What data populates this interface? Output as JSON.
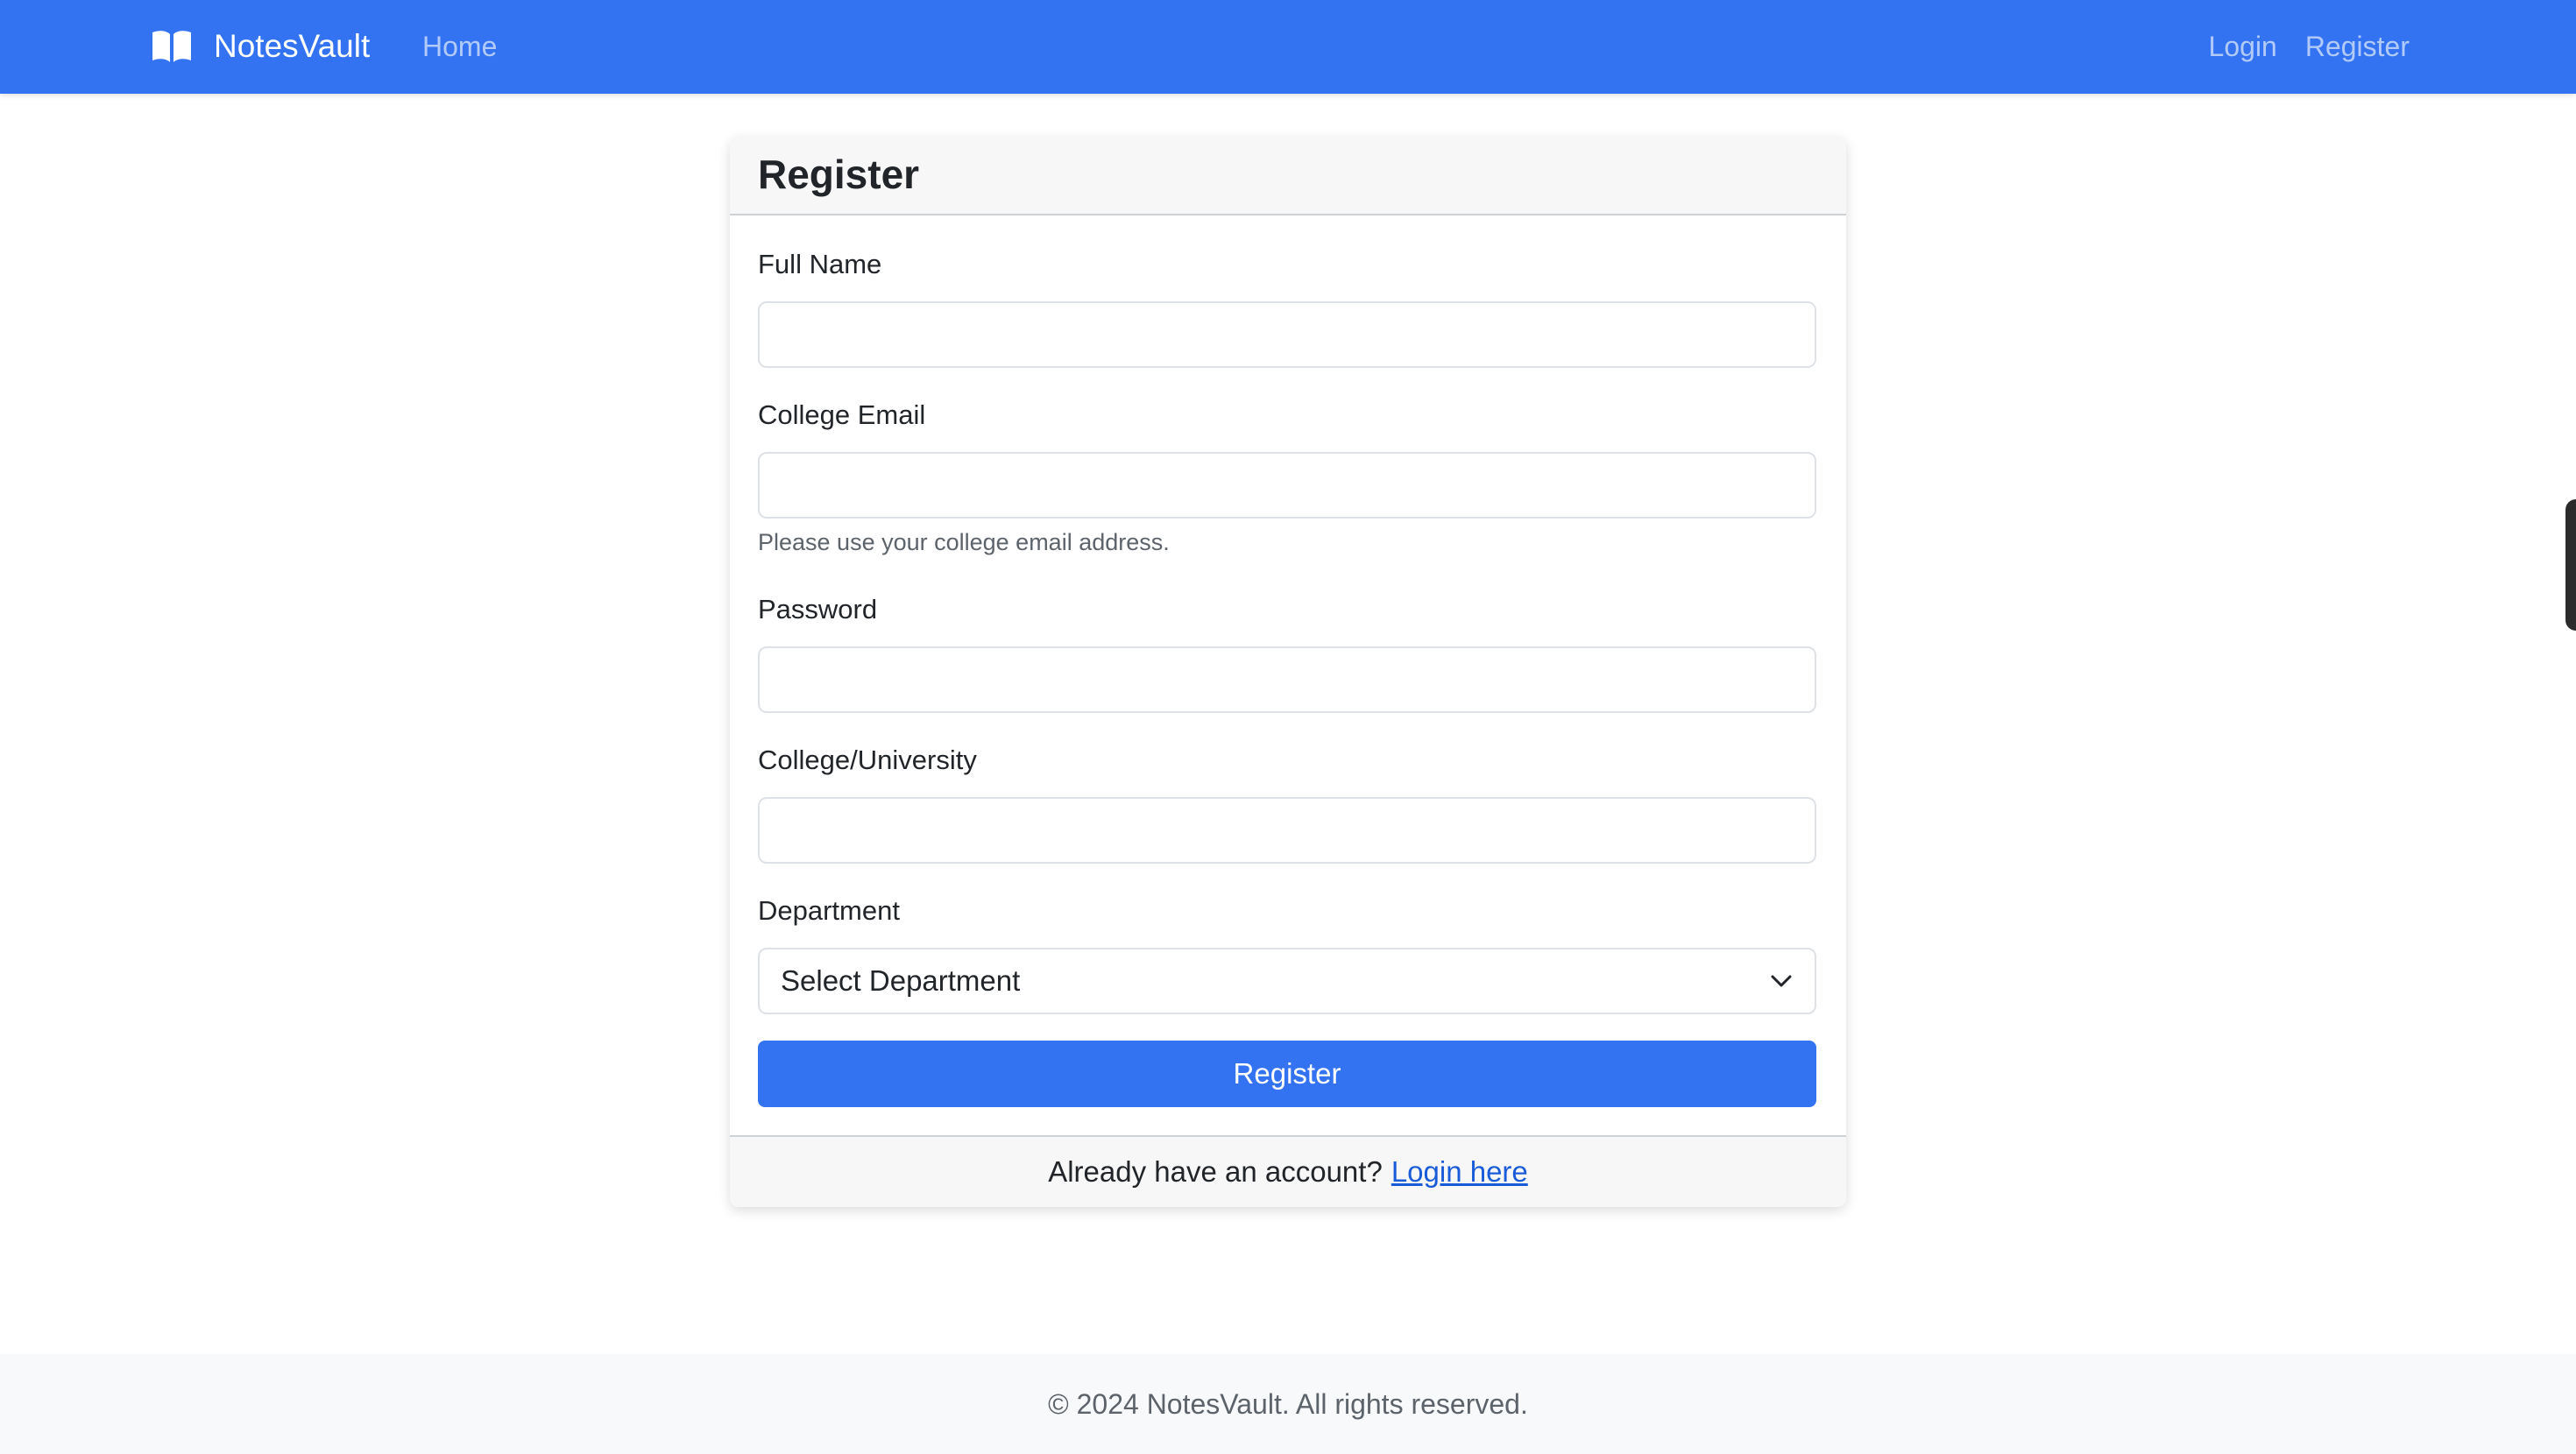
{
  "navbar": {
    "brand": "NotesVault",
    "brand_icon": "open-book-icon",
    "home_label": "Home",
    "login_label": "Login",
    "register_label": "Register",
    "color": "#3373f2"
  },
  "form": {
    "title": "Register",
    "full_name": {
      "label": "Full Name",
      "value": ""
    },
    "college_email": {
      "label": "College Email",
      "value": "",
      "help": "Please use your college email address."
    },
    "password": {
      "label": "Password",
      "value": ""
    },
    "college": {
      "label": "College/University",
      "value": ""
    },
    "department": {
      "label": "Department",
      "selected": "Select Department",
      "icon": "chevron-down-icon"
    },
    "submit_label": "Register",
    "footer_text": "Already have an account?",
    "footer_link": "Login here"
  },
  "footer": {
    "text": "© 2024 NotesVault. All rights reserved."
  }
}
